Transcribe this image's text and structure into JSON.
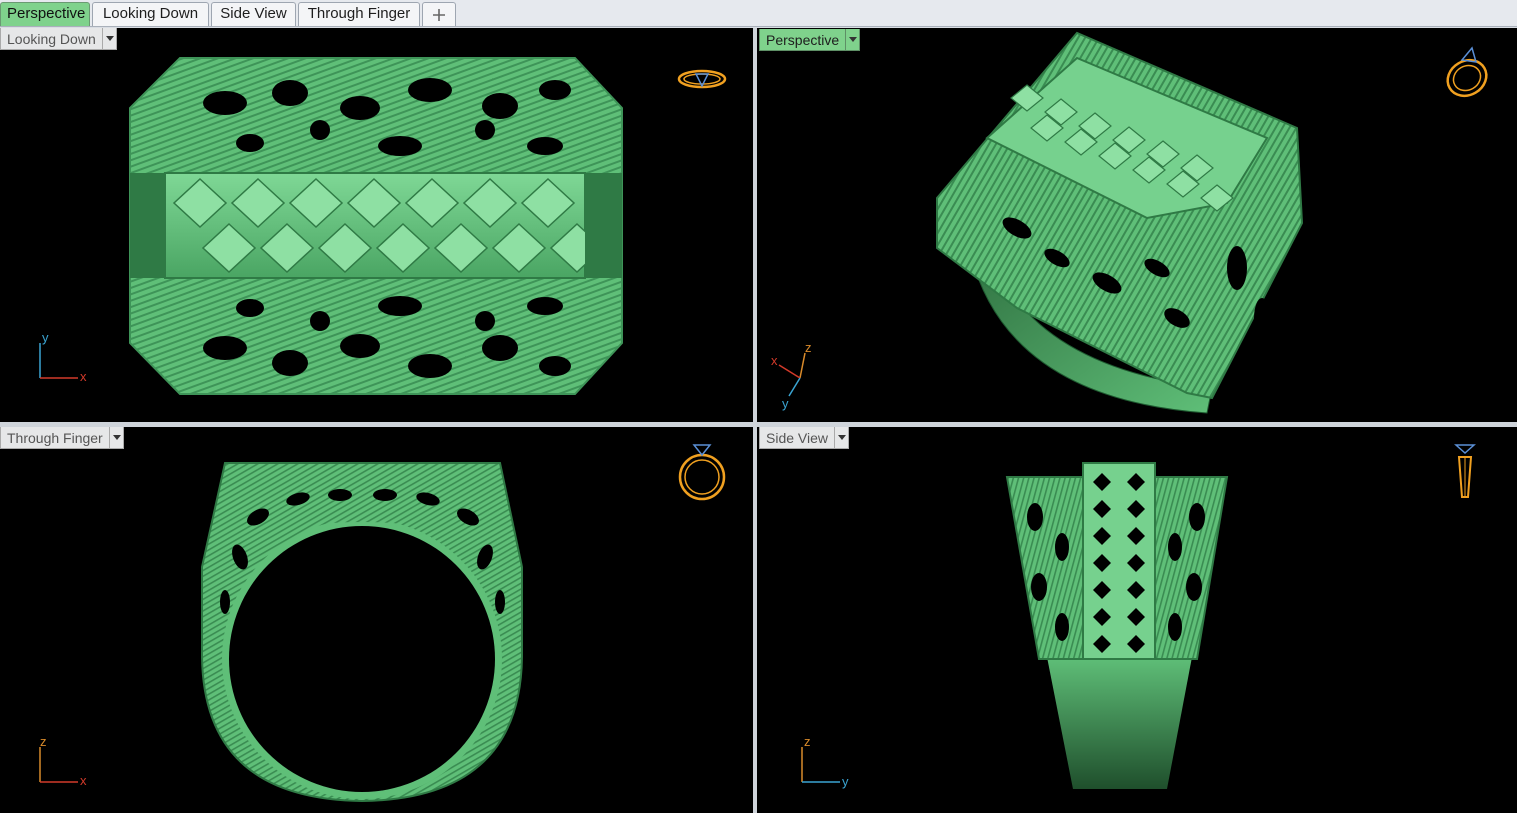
{
  "tabs": [
    {
      "label": "Perspective",
      "active": true
    },
    {
      "label": "Looking Down",
      "active": false
    },
    {
      "label": "Side View",
      "active": false
    },
    {
      "label": "Through Finger",
      "active": false
    }
  ],
  "add_tab_icon": "plus-icon",
  "viewports": {
    "top_left": {
      "label": "Looking Down",
      "axes": {
        "a": "y",
        "b": "x"
      }
    },
    "top_right": {
      "label": "Perspective",
      "active": true,
      "axes": {
        "a": "z",
        "b": "x",
        "c": "y"
      }
    },
    "bottom_left": {
      "label": "Through Finger",
      "axes": {
        "a": "z",
        "b": "x"
      }
    },
    "bottom_right": {
      "label": "Side View",
      "axes": {
        "a": "z",
        "b": "y"
      }
    }
  },
  "colors": {
    "model_green": "#5fbf78",
    "model_dark": "#2f7a45",
    "active_tab": "#7fd28c",
    "gizmo_orange": "#f0a020",
    "gizmo_blue": "#5a8fd6",
    "axis_red": "#d23a2a",
    "axis_blue": "#3aa4d2",
    "axis_orange": "#d88a2a"
  }
}
